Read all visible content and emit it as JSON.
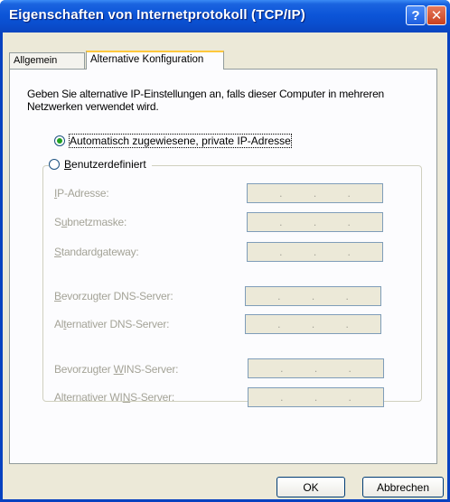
{
  "window": {
    "title": "Eigenschaften von Internetprotokoll (TCP/IP)",
    "help_symbol": "?",
    "close_symbol": "✕"
  },
  "tabs": [
    {
      "label": "Allgemein"
    },
    {
      "label": "Alternative Konfiguration"
    }
  ],
  "description": "Geben Sie alternative IP-Einstellungen an, falls dieser Computer in mehreren Netzwerken verwendet wird.",
  "radio_auto": {
    "label": "Automatisch zugewiesene, private IP-Adresse",
    "selected": true
  },
  "radio_custom": {
    "label_pre": "",
    "label_u": "B",
    "label_post": "enutzerdefiniert",
    "selected": false
  },
  "fields": {
    "ip": {
      "u": "I",
      "post": "P-Adresse:",
      "pre": ""
    },
    "subnet": {
      "pre": "S",
      "u": "u",
      "post": "bnetzmaske:"
    },
    "gateway": {
      "pre": "",
      "u": "S",
      "post": "tandardgateway:"
    },
    "dns1": {
      "pre": "",
      "u": "B",
      "post": "evorzugter DNS-Server:"
    },
    "dns2": {
      "pre": "Al",
      "u": "t",
      "post": "ernativer DNS-Server:"
    },
    "wins1": {
      "pre": "Bevorzugter ",
      "u": "W",
      "post": "INS-Server:"
    },
    "wins2": {
      "pre": "Alternativer WI",
      "u": "N",
      "post": "S-Server:"
    }
  },
  "ip_dot": ".",
  "buttons": {
    "ok": "OK",
    "cancel": "Abbrechen"
  }
}
